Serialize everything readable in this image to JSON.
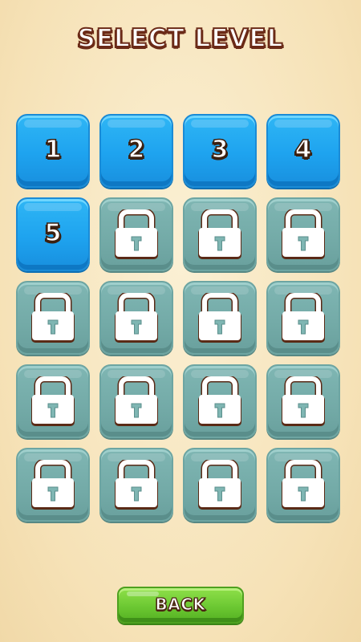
{
  "header": {
    "title": "SELECT LEVEL"
  },
  "levels": [
    {
      "label": "1",
      "state": "unlocked"
    },
    {
      "label": "2",
      "state": "unlocked"
    },
    {
      "label": "3",
      "state": "unlocked"
    },
    {
      "label": "4",
      "state": "unlocked"
    },
    {
      "label": "5",
      "state": "unlocked"
    },
    {
      "label": "",
      "state": "locked",
      "icon": "lock-icon"
    },
    {
      "label": "",
      "state": "locked",
      "icon": "lock-icon"
    },
    {
      "label": "",
      "state": "locked",
      "icon": "lock-icon"
    },
    {
      "label": "",
      "state": "locked",
      "icon": "lock-icon"
    },
    {
      "label": "",
      "state": "locked",
      "icon": "lock-icon"
    },
    {
      "label": "",
      "state": "locked",
      "icon": "lock-icon"
    },
    {
      "label": "",
      "state": "locked",
      "icon": "lock-icon"
    },
    {
      "label": "",
      "state": "locked",
      "icon": "lock-icon"
    },
    {
      "label": "",
      "state": "locked",
      "icon": "lock-icon"
    },
    {
      "label": "",
      "state": "locked",
      "icon": "lock-icon"
    },
    {
      "label": "",
      "state": "locked",
      "icon": "lock-icon"
    },
    {
      "label": "",
      "state": "locked",
      "icon": "lock-icon"
    },
    {
      "label": "",
      "state": "locked",
      "icon": "lock-icon"
    },
    {
      "label": "",
      "state": "locked",
      "icon": "lock-icon"
    },
    {
      "label": "",
      "state": "locked",
      "icon": "lock-icon"
    }
  ],
  "footer": {
    "back_label": "BACK"
  },
  "colors": {
    "background": "#f6e2b7",
    "unlocked_tile": "#1ea3ef",
    "locked_tile": "#73aaa7",
    "back_button": "#6cc832",
    "text_outline": "#6b2a17"
  }
}
